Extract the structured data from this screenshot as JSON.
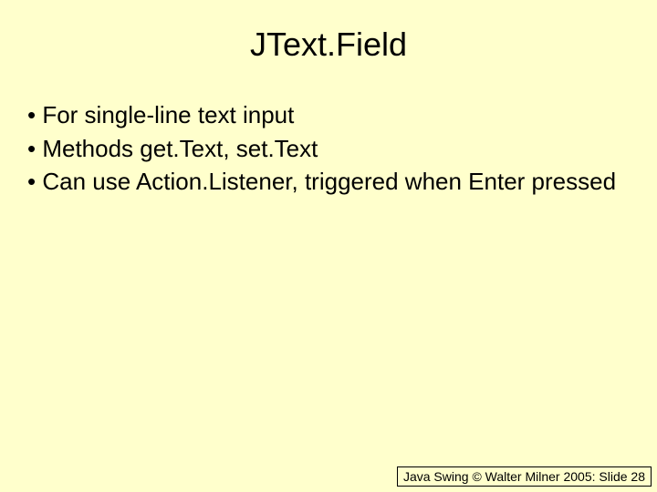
{
  "title": "JText.Field",
  "bullets": [
    "For single-line text input",
    "Methods get.Text, set.Text",
    "Can use Action.Listener, triggered when Enter pressed"
  ],
  "footer": "Java Swing © Walter Milner 2005: Slide 28"
}
